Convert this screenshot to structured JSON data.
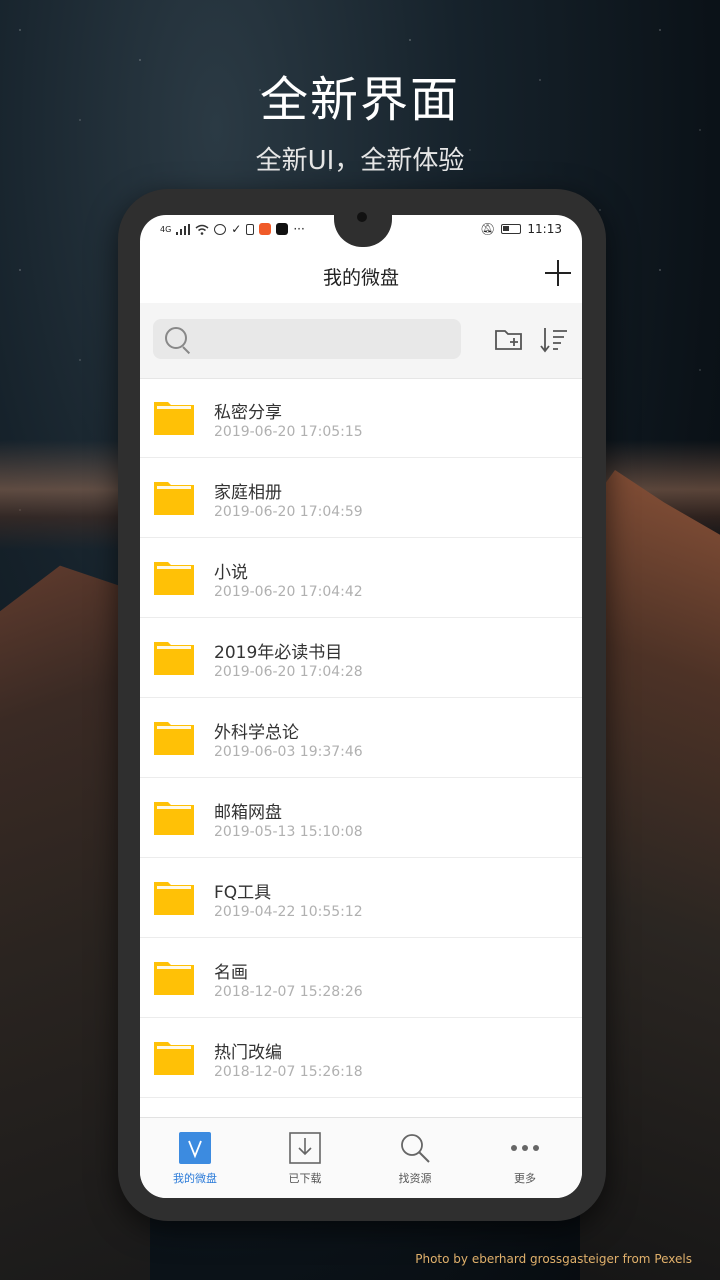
{
  "promo": {
    "title": "全新界面",
    "subtitle": "全新UI，全新体验"
  },
  "statusbar": {
    "time": "11:13",
    "network": "4G",
    "overflow": "···"
  },
  "appbar": {
    "title": "我的微盘"
  },
  "search": {
    "placeholder": "",
    "value": ""
  },
  "files": [
    {
      "name": "私密分享",
      "date": "2019-06-20 17:05:15"
    },
    {
      "name": "家庭相册",
      "date": "2019-06-20 17:04:59"
    },
    {
      "name": "小说",
      "date": "2019-06-20 17:04:42"
    },
    {
      "name": "2019年必读书目",
      "date": "2019-06-20 17:04:28"
    },
    {
      "name": "外科学总论",
      "date": "2019-06-03 19:37:46"
    },
    {
      "name": "邮箱网盘",
      "date": "2019-05-13 15:10:08"
    },
    {
      "name": "FQ工具",
      "date": "2019-04-22 10:55:12"
    },
    {
      "name": "名画",
      "date": "2018-12-07 15:28:26"
    },
    {
      "name": "热门改编",
      "date": "2018-12-07 15:26:18"
    }
  ],
  "tabs": [
    {
      "label": "我的微盘",
      "icon": "vdisk-icon",
      "active": true
    },
    {
      "label": "已下载",
      "icon": "download-icon",
      "active": false
    },
    {
      "label": "找资源",
      "icon": "search-icon",
      "active": false
    },
    {
      "label": "更多",
      "icon": "more-icon",
      "active": false
    }
  ],
  "colors": {
    "folder": "#FFC107",
    "accent": "#2B7BD9"
  },
  "credit": "Photo by eberhard grossgasteiger from Pexels"
}
